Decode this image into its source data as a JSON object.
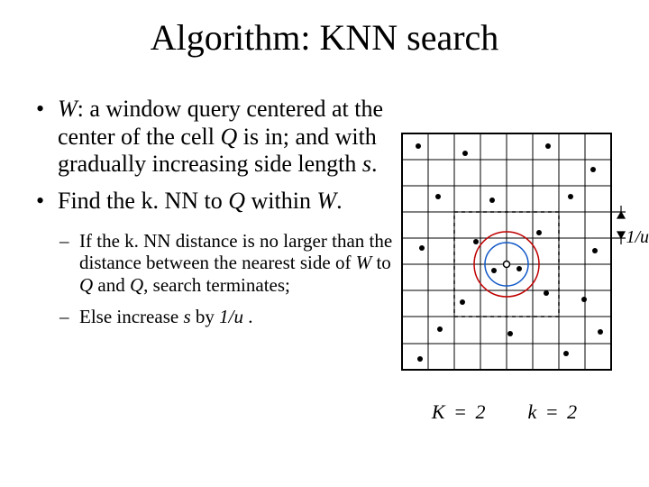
{
  "title": "Algorithm: KNN search",
  "bullets": {
    "b1_p1": "W",
    "b1_p2": ": a window query centered at the center of the cell ",
    "b1_p3": "Q",
    "b1_p4": " is in; and with gradually increasing side length ",
    "b1_p5": "s",
    "b1_p6": ".",
    "b2_p1": "Find the k. NN to ",
    "b2_p2": "Q",
    "b2_p3": " within ",
    "b2_p4": "W",
    "b2_p5": "."
  },
  "subs": {
    "s1_p1": "If the k. NN distance is no larger than the distance between the nearest side of ",
    "s1_p2": "W",
    "s1_p3": " to ",
    "s1_p4": "Q",
    "s1_p5": " and ",
    "s1_p6": "Q",
    "s1_p7": ", search terminates;",
    "s2_p1": "Else increase ",
    "s2_p2": "s",
    "s2_p3": " by ",
    "s2_p4": "1/u",
    "s2_p5": " ."
  },
  "figure": {
    "u_label": "1/u",
    "caption_K": "K = 2",
    "caption_k": "k = 2"
  }
}
